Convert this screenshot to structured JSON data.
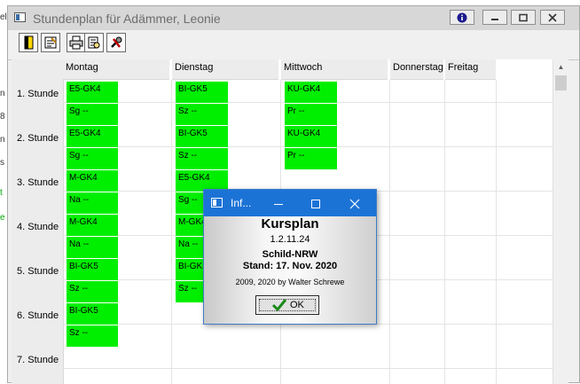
{
  "window": {
    "title": "Stundenplan für Adämmer, Leonie"
  },
  "title_buttons": {
    "info": "info-icon",
    "minimize": "minimize-icon",
    "maximize": "maximize-icon",
    "close": "close-icon"
  },
  "toolbar": {
    "tools": [
      "exit-door-icon",
      "edit-schedule-icon",
      "print-icon",
      "settings-tools-icon"
    ]
  },
  "timetable": {
    "days": [
      "Montag",
      "Dienstag",
      "Mittwoch",
      "Donnerstag",
      "Freitag"
    ],
    "periods": [
      "1. Stunde",
      "2. Stunde",
      "3. Stunde",
      "4. Stunde",
      "5. Stunde",
      "6. Stunde",
      "7. Stunde"
    ],
    "cells": {
      "montag": [
        "E5-GK4",
        "Sg --",
        "E5-GK4",
        "Sg --",
        "M-GK4",
        "Na --",
        "M-GK4",
        "Na --",
        "BI-GK5",
        "Sz --",
        "BI-GK5",
        "Sz --"
      ],
      "dienstag": [
        "BI-GK5",
        "Sz --",
        "BI-GK5",
        "Sz --",
        "E5-GK4",
        "Sg --",
        "M-GK4",
        "Na --",
        "BI-GK5",
        "Sz --"
      ],
      "mittwoch": [
        "KU-GK4",
        "Pr --",
        "KU-GK4",
        "Pr --"
      ]
    },
    "highlight_color": "#00ee00"
  },
  "dialog": {
    "title": "Inf...",
    "app_name": "Kursplan",
    "version": "1.2.11.24",
    "product": "Schild-NRW",
    "stand": "Stand: 17. Nov. 2020",
    "copyright": "2009, 2020 by Walter Schrewe",
    "ok_label": "OK",
    "accent_color": "#1c73d6"
  }
}
